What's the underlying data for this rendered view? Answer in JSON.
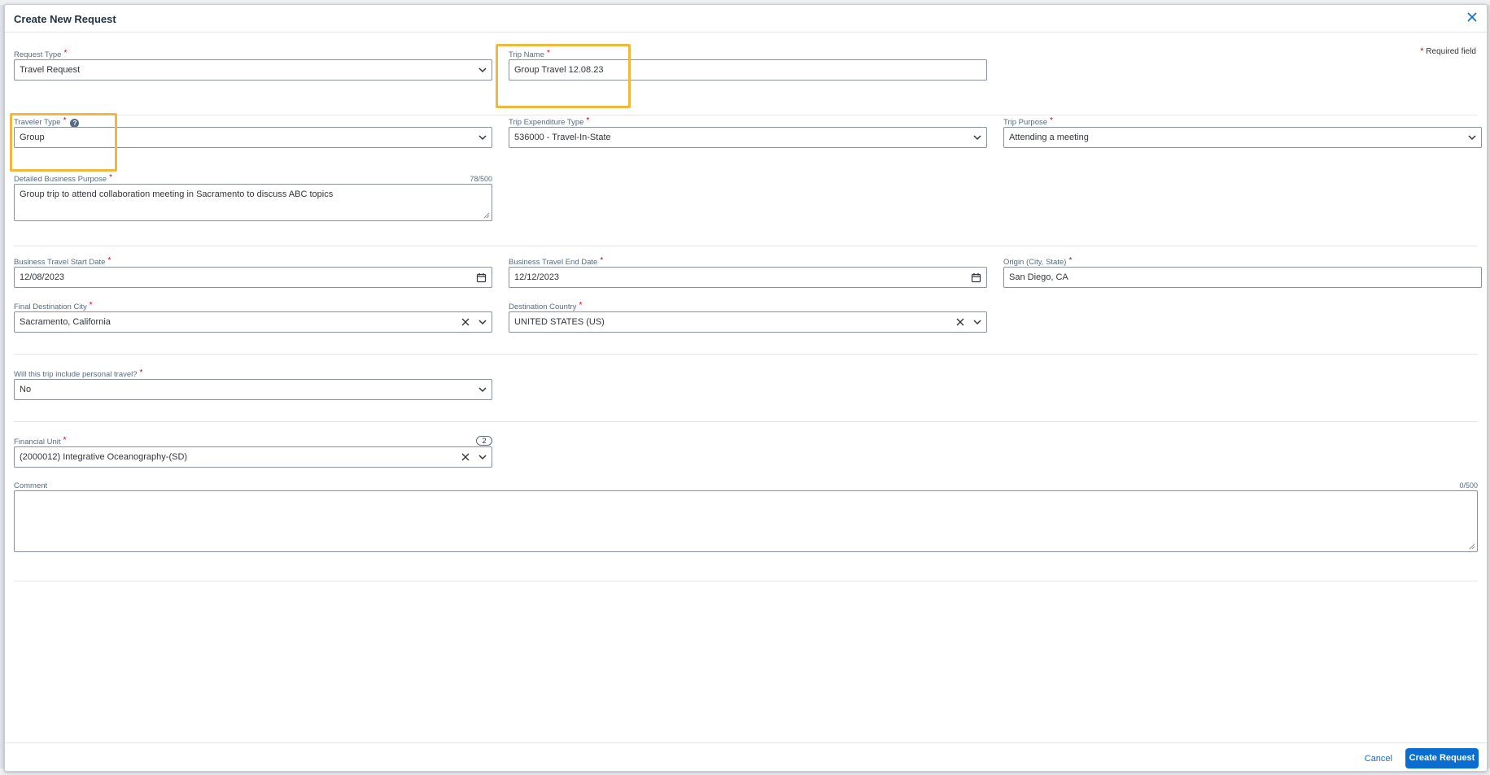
{
  "dialog": {
    "title": "Create New Request",
    "required_note": "Required field",
    "required_star": "*"
  },
  "fields": {
    "request_type": {
      "label": "Request Type",
      "value": "Travel Request"
    },
    "trip_name": {
      "label": "Trip Name",
      "value": "Group Travel 12.08.23"
    },
    "traveler_type": {
      "label": "Traveler Type",
      "value": "Group",
      "help": "?"
    },
    "trip_expenditure_type": {
      "label": "Trip Expenditure Type",
      "value": "536000 - Travel-In-State"
    },
    "trip_purpose": {
      "label": "Trip Purpose",
      "value": "Attending a meeting"
    },
    "business_purpose": {
      "label": "Detailed Business Purpose",
      "counter": "78/500",
      "value": "Group trip to attend collaboration meeting in Sacramento to discuss ABC topics"
    },
    "start_date": {
      "label": "Business Travel Start Date",
      "value": "12/08/2023"
    },
    "end_date": {
      "label": "Business Travel End Date",
      "value": "12/12/2023"
    },
    "origin": {
      "label": "Origin (City, State)",
      "value": "San Diego, CA"
    },
    "final_destination": {
      "label": "Final Destination City",
      "value": "Sacramento, California"
    },
    "destination_country": {
      "label": "Destination Country",
      "value": "UNITED STATES (US)"
    },
    "personal_travel": {
      "label": "Will this trip include personal travel?",
      "value": "No"
    },
    "financial_unit": {
      "label": "Financial Unit",
      "badge": "2",
      "value": "(2000012) Integrative Oceanography-(SD)"
    },
    "comment": {
      "label": "Comment",
      "counter": "0/500",
      "value": ""
    }
  },
  "footer": {
    "cancel_label": "Cancel",
    "create_label": "Create Request"
  },
  "colors": {
    "accent": "#0a6ed1",
    "highlight": "#f2b73d",
    "required": "#d0021b"
  },
  "icons": {
    "close": "close-icon",
    "dropdown": "chevron-down-icon",
    "clear": "clear-icon",
    "calendar": "calendar-icon",
    "help": "help-icon"
  }
}
